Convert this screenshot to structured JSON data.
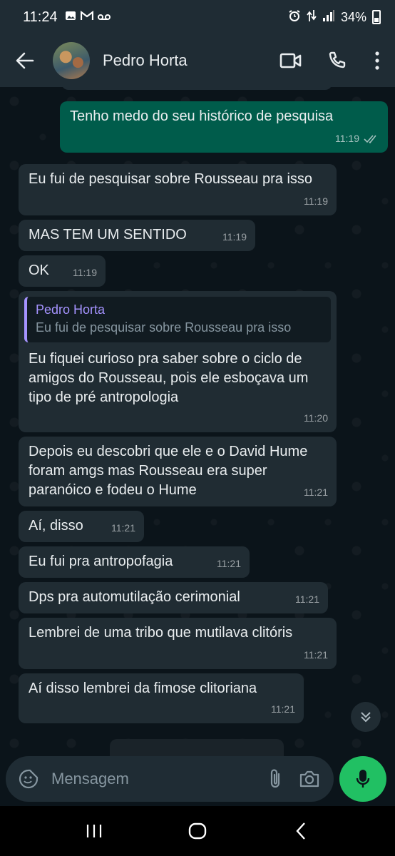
{
  "status_bar": {
    "time": "11:24",
    "battery": "34%"
  },
  "header": {
    "contact_name": "Pedro Horta"
  },
  "messages": [
    {
      "dir": "out",
      "text": "Tenho medo do seu histórico de pesquisa",
      "time": "11:19",
      "read": true
    },
    {
      "dir": "in",
      "text": "Eu fui de pesquisar sobre Rousseau pra isso",
      "time": "11:19"
    },
    {
      "dir": "in",
      "text": "MAS TEM UM SENTIDO",
      "time": "11:19"
    },
    {
      "dir": "in",
      "text": "OK",
      "time": "11:19"
    },
    {
      "dir": "in",
      "quote_author": "Pedro Horta",
      "quote_text": "Eu fui de pesquisar sobre Rousseau pra isso",
      "text": "Eu fiquei curioso pra saber sobre o ciclo de amigos do Rousseau, pois ele esboçava um tipo de pré antropologia",
      "time": "11:20"
    },
    {
      "dir": "in",
      "text": "Depois eu descobri que ele e o David Hume foram amgs mas Rousseau era super paranóico e fodeu o Hume",
      "time": "11:21"
    },
    {
      "dir": "in",
      "text": "Aí, disso",
      "time": "11:21"
    },
    {
      "dir": "in",
      "text": "Eu fui pra antropofagia",
      "time": "11:21"
    },
    {
      "dir": "in",
      "text": "Dps pra automutilação cerimonial",
      "time": "11:21"
    },
    {
      "dir": "in",
      "text": "Lembrei de uma tribo que mutilava clitóris",
      "time": "11:21"
    },
    {
      "dir": "in",
      "text": "Aí disso lembrei da fimose clitoriana",
      "time": "11:21"
    }
  ],
  "composer": {
    "placeholder": "Mensagem"
  },
  "colors": {
    "incoming_bubble": "#202c33",
    "outgoing_bubble": "#005c4b",
    "accent": "#21c063",
    "quote_accent": "#a593ff"
  }
}
